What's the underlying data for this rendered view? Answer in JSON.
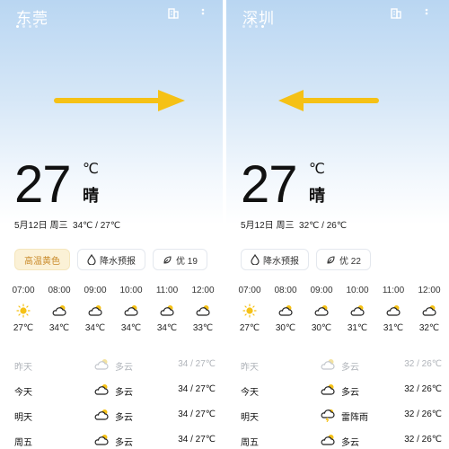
{
  "panels": [
    {
      "city": "东莞",
      "temp": "27",
      "unit": "℃",
      "condition": "晴",
      "date": "5月12日",
      "weekday": "周三",
      "range": "34℃ / 27℃",
      "arrow": "right",
      "warning": "高温黄色",
      "chips": [
        {
          "label": "降水预报",
          "icon": "raindrop-icon"
        },
        {
          "label": "优 19",
          "icon": "leaf-icon"
        }
      ],
      "hourly": [
        {
          "time": "07:00",
          "icon": "sun-icon",
          "temp": "27℃"
        },
        {
          "time": "08:00",
          "icon": "partly-cloudy-icon",
          "temp": "34℃"
        },
        {
          "time": "09:00",
          "icon": "partly-cloudy-icon",
          "temp": "34℃"
        },
        {
          "time": "10:00",
          "icon": "partly-cloudy-icon",
          "temp": "34℃"
        },
        {
          "time": "11:00",
          "icon": "partly-cloudy-icon",
          "temp": "34℃"
        },
        {
          "time": "12:00",
          "icon": "partly-cloudy-icon",
          "temp": "33℃"
        }
      ],
      "daily": [
        {
          "day": "昨天",
          "icon": "partly-cloudy-icon",
          "cond": "多云",
          "range": "34 / 27℃"
        },
        {
          "day": "今天",
          "icon": "partly-cloudy-icon",
          "cond": "多云",
          "range": "34 / 27℃"
        },
        {
          "day": "明天",
          "icon": "partly-cloudy-icon",
          "cond": "多云",
          "range": "34 / 27℃"
        },
        {
          "day": "周五",
          "icon": "partly-cloudy-icon",
          "cond": "多云",
          "range": "34 / 27℃"
        }
      ]
    },
    {
      "city": "深圳",
      "temp": "27",
      "unit": "℃",
      "condition": "晴",
      "date": "5月12日",
      "weekday": "周三",
      "range": "32℃ / 26℃",
      "arrow": "left",
      "warning": "",
      "chips": [
        {
          "label": "降水预报",
          "icon": "raindrop-icon"
        },
        {
          "label": "优 22",
          "icon": "leaf-icon"
        }
      ],
      "hourly": [
        {
          "time": "07:00",
          "icon": "sun-icon",
          "temp": "27℃"
        },
        {
          "time": "08:00",
          "icon": "partly-cloudy-icon",
          "temp": "30℃"
        },
        {
          "time": "09:00",
          "icon": "partly-cloudy-icon",
          "temp": "30℃"
        },
        {
          "time": "10:00",
          "icon": "partly-cloudy-icon",
          "temp": "31℃"
        },
        {
          "time": "11:00",
          "icon": "partly-cloudy-icon",
          "temp": "31℃"
        },
        {
          "time": "12:00",
          "icon": "partly-cloudy-icon",
          "temp": "32℃"
        }
      ],
      "daily": [
        {
          "day": "昨天",
          "icon": "partly-cloudy-icon",
          "cond": "多云",
          "range": "32 / 26℃"
        },
        {
          "day": "今天",
          "icon": "partly-cloudy-icon",
          "cond": "多云",
          "range": "32 / 26℃"
        },
        {
          "day": "明天",
          "icon": "thunder-rain-icon",
          "cond": "雷阵雨",
          "range": "32 / 26℃"
        },
        {
          "day": "周五",
          "icon": "partly-cloudy-icon",
          "cond": "多云",
          "range": "32 / 26℃"
        }
      ]
    }
  ],
  "colors": {
    "arrow": "#f5c116",
    "sun": "#f5c116",
    "warning_bg": "#fbf1d6",
    "warning_text": "#c98a2a"
  }
}
